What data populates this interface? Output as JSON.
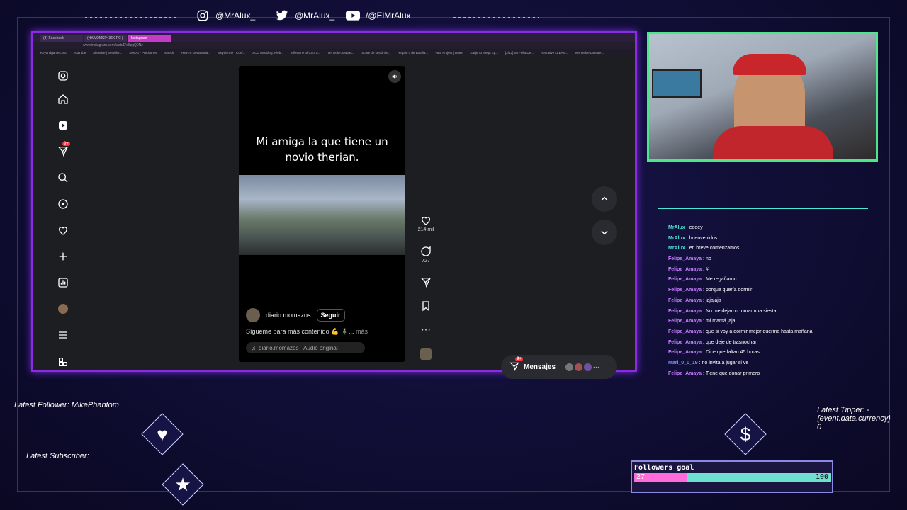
{
  "social": {
    "instagram": "@MrAlux_",
    "twitter": "@MrAlux_",
    "youtube": "/@ElMrAlux"
  },
  "browser": {
    "tabs": [
      "(3) Facebook",
      "(HYA/OMSP436K PC |",
      "Instagram"
    ],
    "url": "www.instagram.com/web/DV9pgQ0Nz",
    "bookmarks": [
      "Keyandgames.pro",
      "YouTube",
      "Alienrice | Servidor...",
      "SMOG - Preclames",
      "Istseck",
      "How To Get Banda...",
      "Weyt.io.me | Conf...",
      "SCO Modding: Nieb...",
      "Milestone of Cool a...",
      "Vet Duke: Ewpas...",
      "Score de sesión in...",
      "Regain o de Batalla...",
      "Vatu Project | Down",
      "Kanje to Mega Ep...",
      "[2/12] Su Fella De...",
      "Redrative (1.BAS...",
      "Vex Rekle Lauture..."
    ]
  },
  "reel": {
    "overlay_text_1": "Mi amiga la que tiene un",
    "overlay_text_2": "novio therian.",
    "author": "diario.momazos",
    "follow": "Seguir",
    "description": "Sígueme para más contenido 💪 🧍‍♂️...",
    "more": "más",
    "audio": "diario.momazos · Audio original",
    "likes": "214 mil",
    "comments": "727"
  },
  "sidebar": {
    "notif_badge": "9+"
  },
  "messages": {
    "label": "Mensajes",
    "badge": "9+"
  },
  "chat": [
    {
      "user": "MrAlux",
      "text": "eeeey",
      "color": "#4ce7d8"
    },
    {
      "user": "MrAlux",
      "text": "buenvenidos",
      "color": "#4ce7d8"
    },
    {
      "user": "MrAlux",
      "text": "en breve comenzamos",
      "color": "#4ce7d8"
    },
    {
      "user": "Felipe_Amaya",
      "text": "no",
      "color": "#c77dff"
    },
    {
      "user": "Felipe_Amaya",
      "text": "#",
      "color": "#c77dff"
    },
    {
      "user": "Felipe_Amaya",
      "text": "Me regañaron",
      "color": "#c77dff"
    },
    {
      "user": "Felipe_Amaya",
      "text": "porque quería dormir",
      "color": "#c77dff"
    },
    {
      "user": "Felipe_Amaya",
      "text": "jajajaja",
      "color": "#c77dff"
    },
    {
      "user": "Felipe_Amaya",
      "text": "No me dejaron tomar una siesta",
      "color": "#c77dff"
    },
    {
      "user": "Felipe_Amaya",
      "text": "mi mamá jaja",
      "color": "#c77dff"
    },
    {
      "user": "Felipe_Amaya",
      "text": "que si voy a dormir mejor duerma hasta mañana",
      "color": "#c77dff"
    },
    {
      "user": "Felipe_Amaya",
      "text": "que deje de trasnochar",
      "color": "#c77dff"
    },
    {
      "user": "Felipe_Amaya",
      "text": "Dice que faltan 45 horas",
      "color": "#c77dff"
    },
    {
      "user": "Mari_0_0_19",
      "text": "no invita a jugar si ve",
      "color": "#7a8cff"
    },
    {
      "user": "Felipe_Amaya",
      "text": "Tiene que donar primero",
      "color": "#c77dff"
    }
  ],
  "overlay": {
    "latest_follower": "Latest Follower: MikePhantom",
    "latest_subscriber": "Latest Subscriber:",
    "latest_tipper_line1": "Latest Tipper: -",
    "latest_tipper_line2": "{event.data.currency}",
    "latest_tipper_line3": "0"
  },
  "goal": {
    "title": "Followers goal",
    "current": "27",
    "max": "100",
    "fraction": 0.27
  }
}
